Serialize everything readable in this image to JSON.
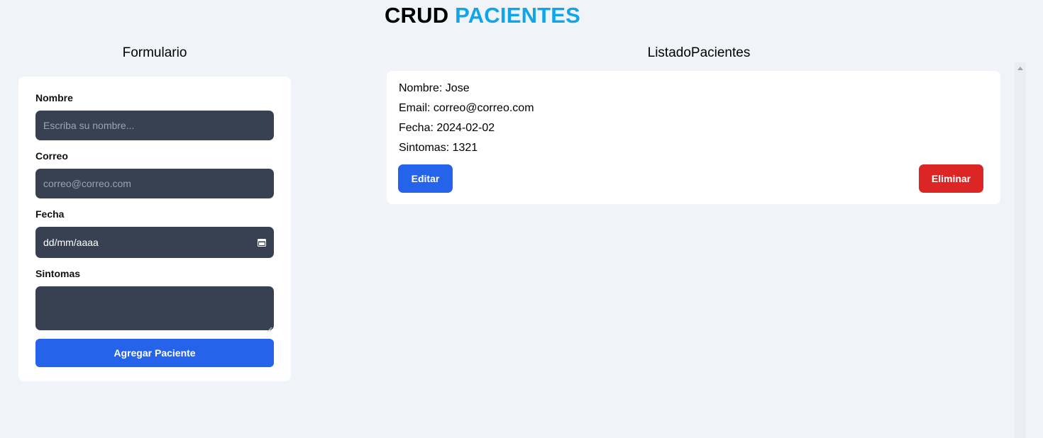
{
  "header": {
    "title_part1": "CRUD",
    "title_part2": "PACIENTES"
  },
  "form": {
    "heading": "Formulario",
    "fields": {
      "nombre": {
        "label": "Nombre",
        "placeholder": "Escriba su nombre...",
        "value": ""
      },
      "correo": {
        "label": "Correo",
        "placeholder": "correo@correo.com",
        "value": ""
      },
      "fecha": {
        "label": "Fecha",
        "placeholder": "dd/mm/aaaa",
        "icon": "calendar-icon"
      },
      "sintomas": {
        "label": "Sintomas",
        "value": ""
      }
    },
    "submit_label": "Agregar Paciente"
  },
  "list": {
    "heading": "ListadoPacientes",
    "patients": [
      {
        "nombre": "Nombre: Jose",
        "email": "Email: correo@correo.com",
        "fecha": "Fecha: 2024-02-02",
        "sintomas": "Sintomas: 1321",
        "edit_label": "Editar",
        "delete_label": "Eliminar"
      }
    ]
  },
  "colors": {
    "background": "#f0f3f8",
    "title_accent": "#0ea5e9",
    "input_bg": "#374151",
    "primary": "#2563eb",
    "danger": "#dc2626"
  }
}
